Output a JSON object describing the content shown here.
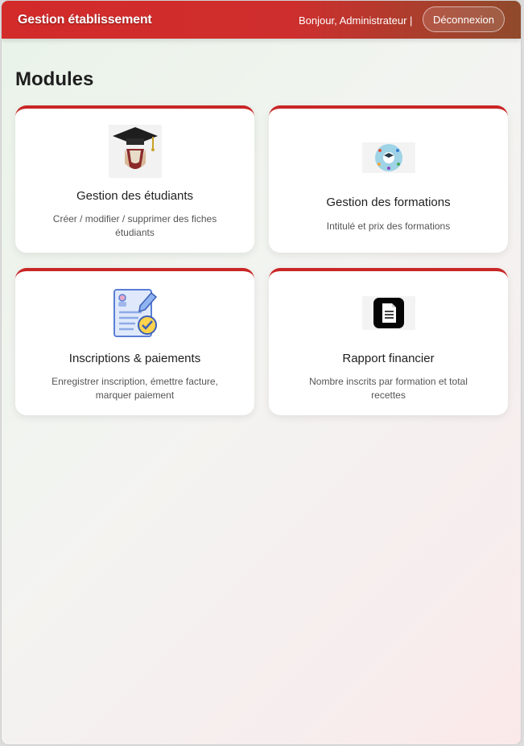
{
  "header": {
    "brand": "Gestion établissement",
    "greeting": "Bonjour, Administrateur |",
    "logout_label": "Déconnexion"
  },
  "main": {
    "title": "Modules",
    "cards": [
      {
        "icon": "graduation-cap-icon",
        "title": "Gestion des étudiants",
        "description": "Créer / modifier / supprimer des fiches étudiants"
      },
      {
        "icon": "training-network-icon",
        "title": "Gestion des formations",
        "description": "Intitulé et prix des formations"
      },
      {
        "icon": "registration-form-icon",
        "title": "Inscriptions & paiements",
        "description": "Enregistrer inscription, émettre facture, marquer paiement"
      },
      {
        "icon": "document-icon",
        "title": "Rapport financier",
        "description": "Nombre inscrits par formation et total recettes"
      }
    ]
  },
  "colors": {
    "header_red": "#d32a2a",
    "header_brown": "#8f4a2c",
    "card_accent": "#c92626"
  }
}
